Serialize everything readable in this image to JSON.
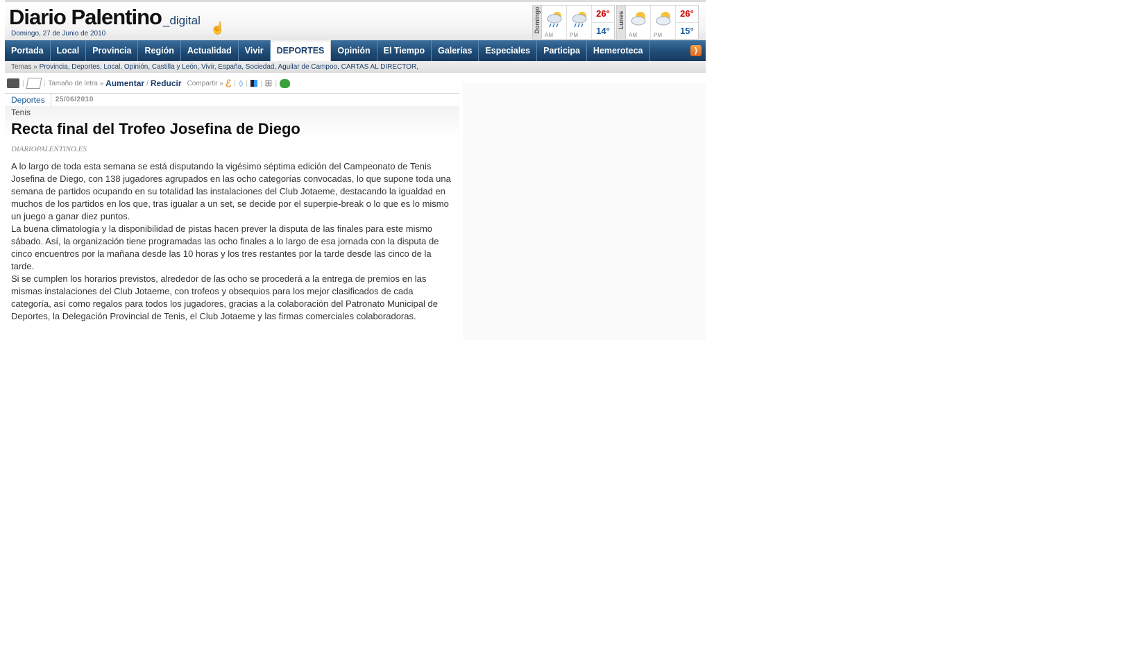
{
  "header": {
    "logo_main": "Diario Palentino",
    "logo_suffix": "_digital",
    "date": "Domingo, 27 de Junio de 2010"
  },
  "weather": [
    {
      "day": "Domingo",
      "am": "AM",
      "pm": "PM",
      "high": "26°",
      "low": "14°",
      "am_icon": "rain-cloud-icon",
      "pm_icon": "rain-cloud-icon"
    },
    {
      "day": "Lunes",
      "am": "AM",
      "pm": "PM",
      "high": "26°",
      "low": "15°",
      "am_icon": "partly-cloudy-icon",
      "pm_icon": "partly-cloudy-icon"
    }
  ],
  "nav": {
    "items": [
      "Portada",
      "Local",
      "Provincia",
      "Región",
      "Actualidad",
      "Vivir",
      "DEPORTES",
      "Opinión",
      "El Tiempo",
      "Galerías",
      "Especiales",
      "Participa",
      "Hemeroteca"
    ],
    "active": "DEPORTES"
  },
  "temas": {
    "label": "Temas »",
    "list": "Provincia, Deportes, Local, Opinión, Castilla y León, Vivir, España, Sociedad, Aguilar de Campoo, CARTAS AL DIRECTOR,"
  },
  "tools": {
    "font_size_label": "Tamaño de letra »",
    "increase": "Aumentar",
    "separator": "/",
    "decrease": "Reducir",
    "share_label": "Compartir »"
  },
  "article": {
    "section": "Deportes",
    "date": "25/06/2010",
    "kicker": "Tenis",
    "title": "Recta final del Trofeo Josefina de Diego",
    "source": "DIARIOPALENTINO.ES",
    "paragraphs": [
      "A lo largo de toda esta semana se está disputando la vigésimo séptima edición del Campeonato de Tenis Josefina de Diego, con 138 jugadores agrupados en las ocho categorías convocadas, lo que supone toda una semana de partidos ocupando en su totalidad las instalaciones del Club Jotaeme, destacando la igualdad en muchos de los partidos en los que, tras igualar a un set, se decide por el superpie-break o lo que es lo mismo un juego a ganar diez puntos.",
      "La buena climatología y la disponibilidad de pistas hacen prever la disputa de las finales para este mismo sábado. Así, la organización tiene programadas las ocho finales a lo largo de esa jornada con la disputa de cinco encuentros por la mañana desde las 10 horas y los tres restantes por la tarde desde las cinco de la tarde.",
      "Si se cumplen los horarios previstos, alrededor de las ocho se procederá a la entrega de premios en las mismas instalaciones del Club Jotaeme, con trofeos y obsequios para los mejor clasificados de cada categoría, así como regalos para todos los jugadores, gracias a la colaboración del Patronato Municipal de Deportes, la Delegación Provincial de Tenis, el Club Jotaeme y las firmas comerciales colaboradoras."
    ]
  },
  "colors": {
    "nav_blue": "#1f4c77",
    "link_blue": "#1b5b9a",
    "temp_high": "#cc0000",
    "temp_low": "#1a5a9a",
    "rss_orange": "#e0641c"
  }
}
